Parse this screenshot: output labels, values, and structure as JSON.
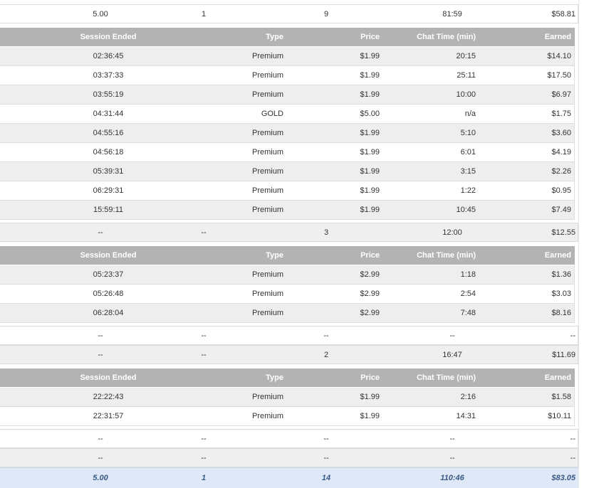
{
  "summary_headers_visible": false,
  "session_headers": {
    "session_ended": "Session Ended",
    "type": "Type",
    "price": "Price",
    "chat_time": "Chat Time (min)",
    "earned": "Earned"
  },
  "top_summary": {
    "rate": "5.00",
    "a": "1",
    "sessions": "9",
    "chat_time": "81:59",
    "earned": "$58.81"
  },
  "group1": {
    "sessions": [
      {
        "ended": "02:36:45",
        "type": "Premium",
        "price": "$1.99",
        "time": "20:15",
        "earned": "$14.10"
      },
      {
        "ended": "03:37:33",
        "type": "Premium",
        "price": "$1.99",
        "time": "25:11",
        "earned": "$17.50"
      },
      {
        "ended": "03:55:19",
        "type": "Premium",
        "price": "$1.99",
        "time": "10:00",
        "earned": "$6.97"
      },
      {
        "ended": "04:31:44",
        "type": "GOLD",
        "price": "$5.00",
        "time": "n/a",
        "earned": "$1.75"
      },
      {
        "ended": "04:55:16",
        "type": "Premium",
        "price": "$1.99",
        "time": "5:10",
        "earned": "$3.60"
      },
      {
        "ended": "04:56:18",
        "type": "Premium",
        "price": "$1.99",
        "time": "6:01",
        "earned": "$4.19"
      },
      {
        "ended": "05:39:31",
        "type": "Premium",
        "price": "$1.99",
        "time": "3:15",
        "earned": "$2.26"
      },
      {
        "ended": "06:29:31",
        "type": "Premium",
        "price": "$1.99",
        "time": "1:22",
        "earned": "$0.95"
      },
      {
        "ended": "15:59:11",
        "type": "Premium",
        "price": "$1.99",
        "time": "10:45",
        "earned": "$7.49"
      }
    ]
  },
  "summary2": {
    "rate": "--",
    "a": "--",
    "sessions": "3",
    "chat_time": "12:00",
    "earned": "$12.55"
  },
  "group2": {
    "sessions": [
      {
        "ended": "05:23:37",
        "type": "Premium",
        "price": "$2.99",
        "time": "1:18",
        "earned": "$1.36"
      },
      {
        "ended": "05:26:48",
        "type": "Premium",
        "price": "$2.99",
        "time": "2:54",
        "earned": "$3.03"
      },
      {
        "ended": "06:28:04",
        "type": "Premium",
        "price": "$2.99",
        "time": "7:48",
        "earned": "$8.16"
      }
    ]
  },
  "summary3": {
    "rate": "--",
    "a": "--",
    "sessions": "--",
    "chat_time": "--",
    "earned": "--"
  },
  "summary4": {
    "rate": "--",
    "a": "--",
    "sessions": "2",
    "chat_time": "16:47",
    "earned": "$11.69"
  },
  "group3": {
    "sessions": [
      {
        "ended": "22:22:43",
        "type": "Premium",
        "price": "$1.99",
        "time": "2:16",
        "earned": "$1.58"
      },
      {
        "ended": "22:31:57",
        "type": "Premium",
        "price": "$1.99",
        "time": "14:31",
        "earned": "$10.11"
      }
    ]
  },
  "summary5": {
    "rate": "--",
    "a": "--",
    "sessions": "--",
    "chat_time": "--",
    "earned": "--"
  },
  "summary6": {
    "rate": "--",
    "a": "--",
    "sessions": "--",
    "chat_time": "--",
    "earned": "--"
  },
  "total": {
    "rate": "5.00",
    "a": "1",
    "sessions": "14",
    "chat_time": "110:46",
    "earned": "$83.05"
  }
}
